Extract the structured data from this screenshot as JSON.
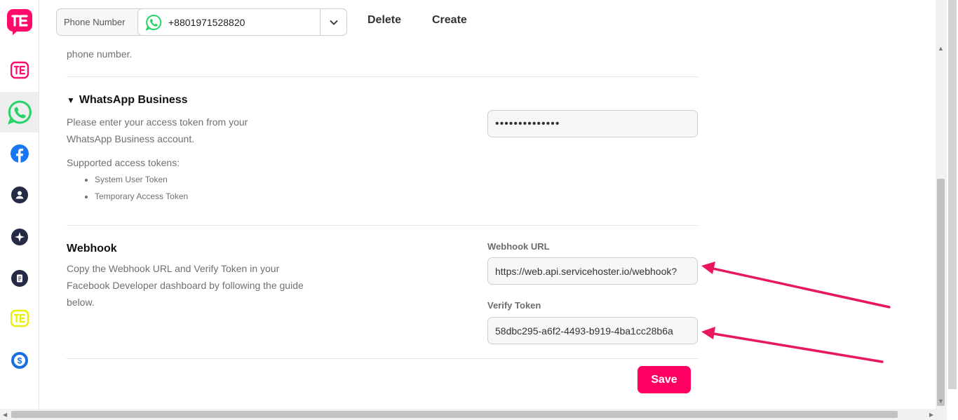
{
  "topbar": {
    "phone_label": "Phone Number",
    "phone_value": "+8801971528820",
    "delete_label": "Delete",
    "create_label": "Create"
  },
  "sidebar": {
    "items": [
      {
        "icon": "brand-logo-icon",
        "color": "#ff0a6c"
      },
      {
        "icon": "brand-icon",
        "color": "#ff0a6c"
      },
      {
        "icon": "whatsapp-icon",
        "color": "#25d366"
      },
      {
        "icon": "facebook-icon",
        "color": "#1877f2"
      },
      {
        "icon": "contact-icon",
        "color": "#252a45"
      },
      {
        "icon": "sparkle-icon",
        "color": "#252a45"
      },
      {
        "icon": "document-icon",
        "color": "#252a45"
      },
      {
        "icon": "brand-alt-icon",
        "color": "#e6f000"
      },
      {
        "icon": "dollar-icon",
        "color": "#1a6ee0"
      }
    ]
  },
  "phone_section": {
    "trailing_text": "phone number."
  },
  "whatsapp_business": {
    "title": "WhatsApp Business",
    "description_line1": "Please enter your access token from your",
    "description_line2": "WhatsApp Business account.",
    "supported_label": "Supported access tokens:",
    "tokens": [
      "System User Token",
      "Temporary Access Token"
    ],
    "access_token_value": "••••••••••••••"
  },
  "webhook": {
    "title": "Webhook",
    "description_line1": "Copy the Webhook URL and Verify Token in your",
    "description_line2": "Facebook Developer dashboard by following the guide",
    "description_line3": "below.",
    "url_label": "Webhook URL",
    "url_value": "https://web.api.servicehoster.io/webhook?",
    "token_label": "Verify Token",
    "token_value": "58dbc295-a6f2-4493-b919-4ba1cc28b6a"
  },
  "save_label": "Save",
  "colors": {
    "accent": "#ff0062",
    "annotation_arrow": "#e8185f"
  }
}
